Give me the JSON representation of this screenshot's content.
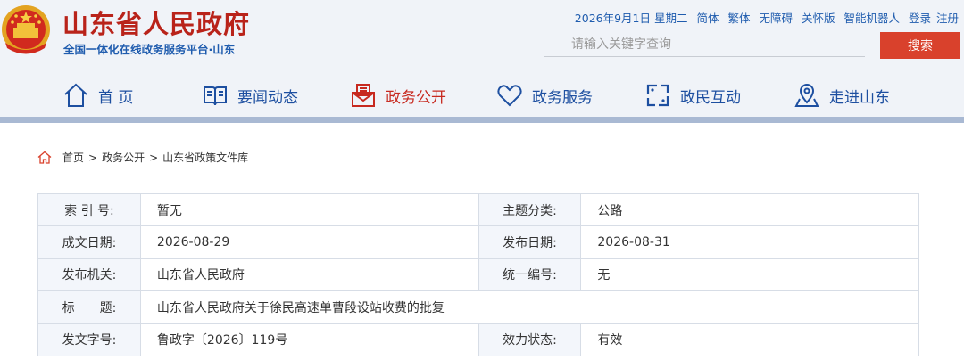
{
  "header": {
    "title": "山东省人民政府",
    "subtitle": "全国一体化在线政务服务平台·山东",
    "emblem_icon": "national-emblem-icon"
  },
  "toplinks": {
    "date": "2026年9月1日 星期二",
    "simplified": "简体",
    "traditional": "繁体",
    "accessibility": "无障碍",
    "elderly": "关怀版",
    "robot": "智能机器人",
    "login": "登录",
    "register": "注册"
  },
  "search": {
    "placeholder": "请输入关键字查询",
    "button": "搜索"
  },
  "nav": [
    {
      "label": "首 页",
      "icon": "home-icon"
    },
    {
      "label": "要闻动态",
      "icon": "book-icon"
    },
    {
      "label": "政务公开",
      "icon": "envelope-icon",
      "active": true
    },
    {
      "label": "政务服务",
      "icon": "heart-icon"
    },
    {
      "label": "政民互动",
      "icon": "interaction-icon"
    },
    {
      "label": "走进山东",
      "icon": "location-icon"
    }
  ],
  "breadcrumb": {
    "icon": "home-icon",
    "items": [
      "首页",
      "政务公开",
      "山东省政策文件库"
    ],
    "separator": ">"
  },
  "meta": {
    "index_label": "索 引 号:",
    "index_value": "暂无",
    "topic_label": "主题分类:",
    "topic_value": "公路",
    "written_label": "成文日期:",
    "written_value": "2026-08-29",
    "published_label": "发布日期:",
    "published_value": "2026-08-31",
    "issuer_label": "发布机关:",
    "issuer_value": "山东省人民政府",
    "serial_label": "统一编号:",
    "serial_value": "无",
    "title_label": "标　　题:",
    "title_value": "山东省人民政府关于徐民高速单曹段设站收费的批复",
    "doc_no_label": "发文字号:",
    "doc_no_value": "鲁政字〔2026〕119号",
    "status_label": "效力状态:",
    "status_value": "有效"
  },
  "colors": {
    "brand_red": "#b9231a",
    "brand_blue": "#1f5cae",
    "search_button": "#d9412c",
    "status_valid": "#d9412c"
  }
}
